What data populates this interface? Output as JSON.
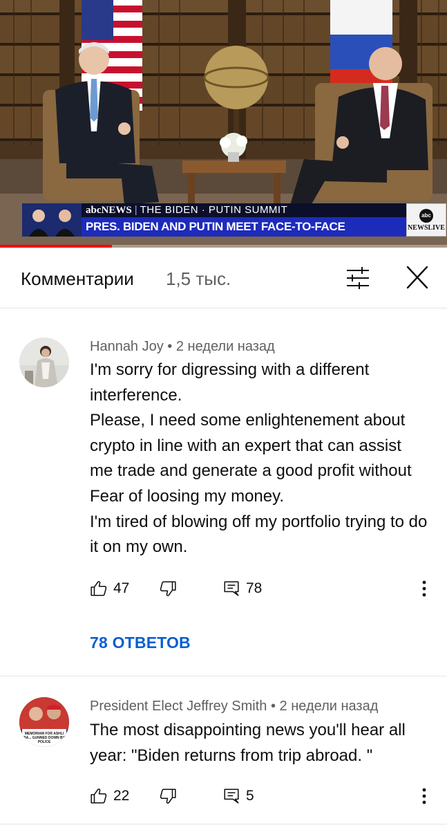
{
  "video": {
    "lower_third": {
      "brand": "abcNEWS",
      "show": "THE BIDEN · PUTIN SUMMIT",
      "headline": "PRES. BIDEN AND PUTIN MEET FACE-TO-FACE",
      "logo_abc": "abc",
      "logo_text": "NEWSLIVE"
    },
    "progress_fraction": 0.25
  },
  "comments_header": {
    "title": "Комментарии",
    "count": "1,5 тыс.",
    "sort_icon": "sliders-icon",
    "close_icon": "close-icon"
  },
  "comments": [
    {
      "author": "Hannah Joy",
      "time": "2 недели назад",
      "lines": [
        "I'm sorry for digressing with a different interference.",
        "Please, I need some enlightenement about crypto in line with an expert that can assist me trade and generate a good profit without Fear of loosing my money.",
        "I'm tired of blowing off my portfolio trying to do it on my own."
      ],
      "likes": "47",
      "replies": "78",
      "replies_link": "78 ОТВЕТОВ"
    },
    {
      "author": "President Elect Jeffrey Smith",
      "time": "2 недели назад",
      "lines": [
        "The most disappointing news you'll hear all year: \"Biden returns from trip abroad. \""
      ],
      "likes": "22",
      "replies": "5",
      "avatar_caption": "MEMORIAM FOR ASHLI BA... GUNNED DOWN BY POLICE"
    }
  ],
  "colors": {
    "accent_link": "#065fd4",
    "progress": "#ff0000",
    "secondary_text": "#606060"
  }
}
